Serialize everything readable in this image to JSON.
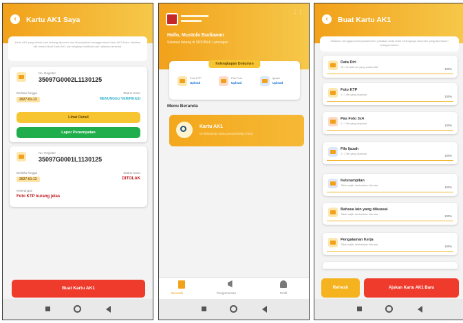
{
  "screen1": {
    "title": "Kartu AK1 Saya",
    "intro": "Kartu AK1 yang aktual saat sedang diproses dan disampaikan menggunakan Kartu AK1 Anda, silahkan klik tombol Buat Kartu AK1 dan lengkapi verifikasi dari halaman tersebut.",
    "cards": [
      {
        "reg_label": "No. Register",
        "reg_no": "35097G0002L1130125",
        "date_label": "Berlaku hingga",
        "date": "2027-01-13",
        "status_label": "Status Kartu",
        "status": "MENUNGGU VERIFIKASI",
        "status_color": "#34b3c9",
        "btn_detail": "Lihat Detail",
        "btn_lapor": "Lapor Penempatan"
      },
      {
        "reg_label": "No. Register",
        "reg_no": "35097G0001L1130125",
        "date_label": "Berlaku hingga",
        "date": "2027-01-13",
        "status_label": "Status Kartu",
        "status": "DITOLAK",
        "status_color": "#c0151b",
        "note_label": "Keterangan",
        "note": "Foto KTP kurang jelas"
      }
    ],
    "btn_buat": "Buat Kartu AK1"
  },
  "screen2": {
    "welcome": "Hallo, Mustofa Budiawan",
    "sub": "Selamat datang di SIDOBEK Lamongan",
    "kelengkapan_title": "Kelengkapan Dokumen",
    "docs": [
      {
        "label": "Foto KTP",
        "status": "Upload"
      },
      {
        "label": "Pas Foto",
        "status": "Upload"
      },
      {
        "label": "Ijazah",
        "status": "Upload"
      }
    ],
    "menu_title": "Menu Beranda",
    "menu_card_title": "Kartu AK1",
    "menu_card_sub": "Isi kebutuhan kartu pencari kerja (AK1)",
    "tabs": [
      {
        "label": "Beranda"
      },
      {
        "label": "Pengumuman"
      },
      {
        "label": "Profil"
      }
    ]
  },
  "screen3": {
    "title": "Buat Kartu AK1",
    "intro": "Silahkan menggapai persyaratan AK1 pastikan anda telah melengkapi dokumen yang diperlukan sebagai berikut",
    "items": [
      {
        "title": "Data Diri",
        "sub": "16 / 16 data diri yang sudah diisi",
        "pct": "100%"
      },
      {
        "title": "Foto KTP",
        "sub": "1 / 1 file yang diupload",
        "pct": "100%"
      },
      {
        "title": "Pas Foto 3x4",
        "sub": "1 / 1 file yang diupload",
        "pct": "100%"
      },
      {
        "title": "File Ijazah",
        "sub": "1 / 1 file yang diupload",
        "pct": "100%"
      },
      {
        "title": "Keterampilan",
        "sub": "Tidak wajib, tambahkan bila ada",
        "pct": "100%"
      },
      {
        "title": "Bahasa lain yang dikuasai",
        "sub": "Tidak wajib, tambahkan bila ada",
        "pct": "100%"
      },
      {
        "title": "Pengalaman Kerja",
        "sub": "Tidak wajib, tambahkan bila ada",
        "pct": "100%"
      }
    ],
    "btn_refresh": "Refresh",
    "btn_ajukan": "Ajukan Kartu AK1 Baru"
  }
}
